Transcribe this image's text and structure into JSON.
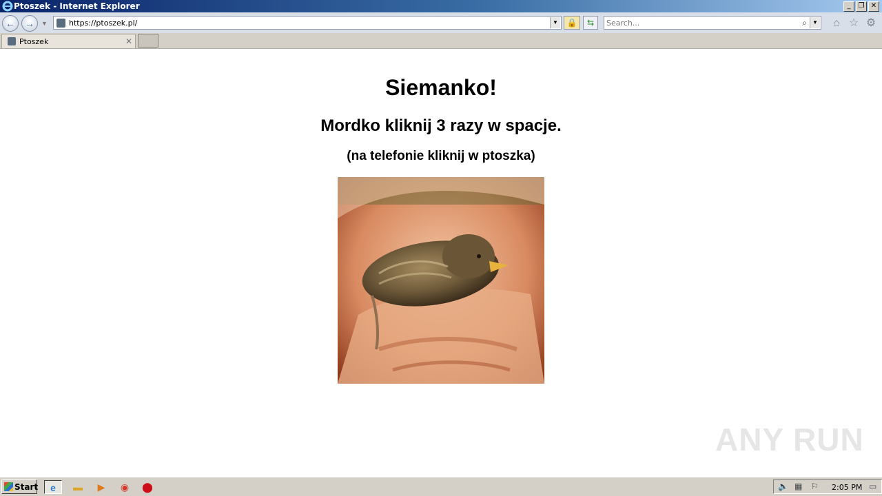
{
  "window": {
    "title": "Ptoszek - Internet Explorer",
    "minimize_icon": "_",
    "restore_icon": "❐",
    "close_icon": "✕"
  },
  "navbar": {
    "url": "https://ptoszek.pl/",
    "search_placeholder": "Search..."
  },
  "tabs": [
    {
      "label": "Ptoszek"
    }
  ],
  "page": {
    "heading": "Siemanko!",
    "subheading": "Mordko kliknij 3 razy w spacje.",
    "note": "(na telefonie kliknij w ptoszka)",
    "image_description": "baby bird sitting in a hand"
  },
  "watermark": "ANY RUN",
  "taskbar": {
    "start_label": "Start",
    "clock": "2:05 PM"
  },
  "colors": {
    "titlebar_start": "#0a246a",
    "content_bg": "#ffffff"
  }
}
